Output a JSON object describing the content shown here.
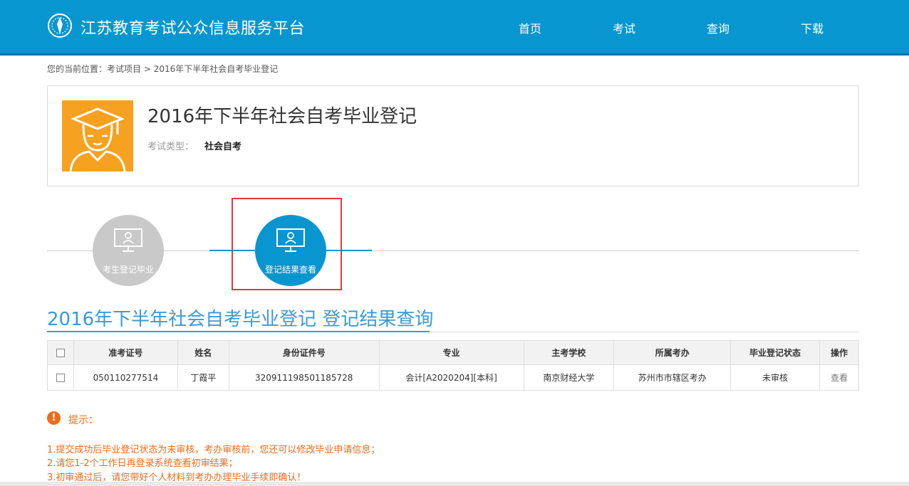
{
  "header": {
    "title": "江苏教育考试公众信息服务平台",
    "nav": [
      "首页",
      "考试",
      "查询",
      "下载"
    ]
  },
  "breadcrumb": {
    "prefix": "您的当前位置：",
    "items": [
      "考试项目",
      "2016年下半年社会自考毕业登记"
    ],
    "separator": " > "
  },
  "exam": {
    "title": "2016年下半年社会自考毕业登记",
    "type_label": "考试类型：",
    "type_value": "社会自考"
  },
  "steps": [
    {
      "label": "考生登记毕业",
      "state": "inactive"
    },
    {
      "label": "登记结果查看",
      "state": "active"
    }
  ],
  "section": {
    "title": "2016年下半年社会自考毕业登记 登记结果查询"
  },
  "table": {
    "headers": [
      "准考证号",
      "姓名",
      "身份证件号",
      "专业",
      "主考学校",
      "所属考办",
      "毕业登记状态",
      "操作"
    ],
    "rows": [
      [
        "050110277514",
        "丁霞平",
        "320911198501185728",
        "会计[A2020204][本科]",
        "南京财经大学",
        "苏州市市辖区考办",
        "未审核",
        "查看"
      ]
    ]
  },
  "tips": {
    "icon": "!",
    "title": "提示：",
    "lines": [
      "1.提交成功后毕业登记状态为未审核，考办审核前，您还可以修改毕业申请信息；",
      "2.请您1-2个工作日再登录系统查看初审结果；",
      "3.初审通过后，请您带好个人材料到考办办理毕业手续即确认！"
    ]
  },
  "colors": {
    "header_bg": "#0796cf",
    "accent": "#3a9ad9",
    "avatar_bg": "#f7a121",
    "tip": "#f06a1a",
    "highlight": "#e23b3b"
  }
}
